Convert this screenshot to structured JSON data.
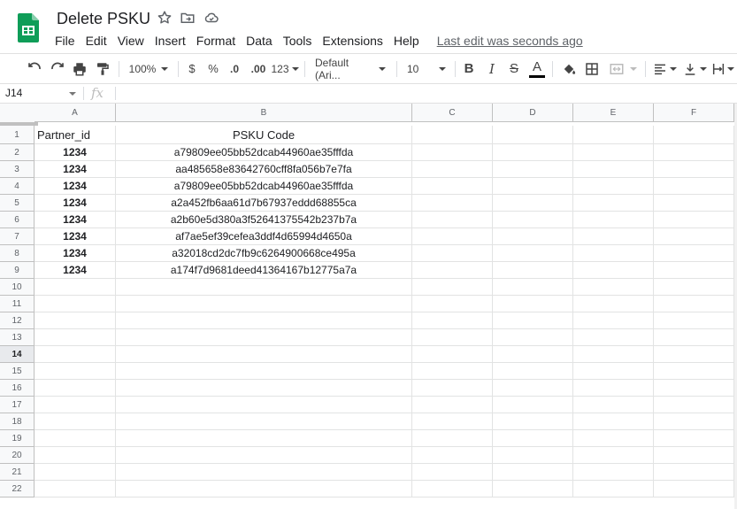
{
  "app": {
    "title": "Delete PSKU",
    "last_edit": "Last edit was seconds ago",
    "brand_color": "#0F9D58"
  },
  "menu": [
    "File",
    "Edit",
    "View",
    "Insert",
    "Format",
    "Data",
    "Tools",
    "Extensions",
    "Help"
  ],
  "toolbar": {
    "zoom": "100%",
    "currency": "$",
    "percent": "%",
    "decrease_decimal": ".0",
    "increase_decimal": ".00",
    "more_formats": "123",
    "font": "Default (Ari...",
    "font_size": "10",
    "bold": "B",
    "italic": "I",
    "strike": "S",
    "text_color": "A"
  },
  "formula_bar": {
    "name_box": "J14",
    "fx": "fx",
    "content": ""
  },
  "sheet": {
    "columns": [
      "A",
      "B",
      "C",
      "D",
      "E",
      "F"
    ],
    "rows": [
      "1",
      "2",
      "3",
      "4",
      "5",
      "6",
      "7",
      "8",
      "9",
      "10",
      "11",
      "12",
      "13",
      "14",
      "15",
      "16",
      "17",
      "18",
      "19",
      "20",
      "21",
      "22"
    ],
    "selected_row": "14",
    "header": [
      "Partner_id",
      "PSKU Code"
    ],
    "data": [
      [
        "1234",
        "a79809ee05bb52dcab44960ae35fffda"
      ],
      [
        "1234",
        "aa485658e83642760cff8fa056b7e7fa"
      ],
      [
        "1234",
        "a79809ee05bb52dcab44960ae35fffda"
      ],
      [
        "1234",
        "a2a452fb6aa61d7b67937eddd68855ca"
      ],
      [
        "1234",
        "a2b60e5d380a3f52641375542b237b7a"
      ],
      [
        "1234",
        "af7ae5ef39cefea3ddf4d65994d4650a"
      ],
      [
        "1234",
        "a32018cd2dc7fb9c6264900668ce495a"
      ],
      [
        "1234",
        "a174f7d9681deed41364167b12775a7a"
      ]
    ]
  }
}
